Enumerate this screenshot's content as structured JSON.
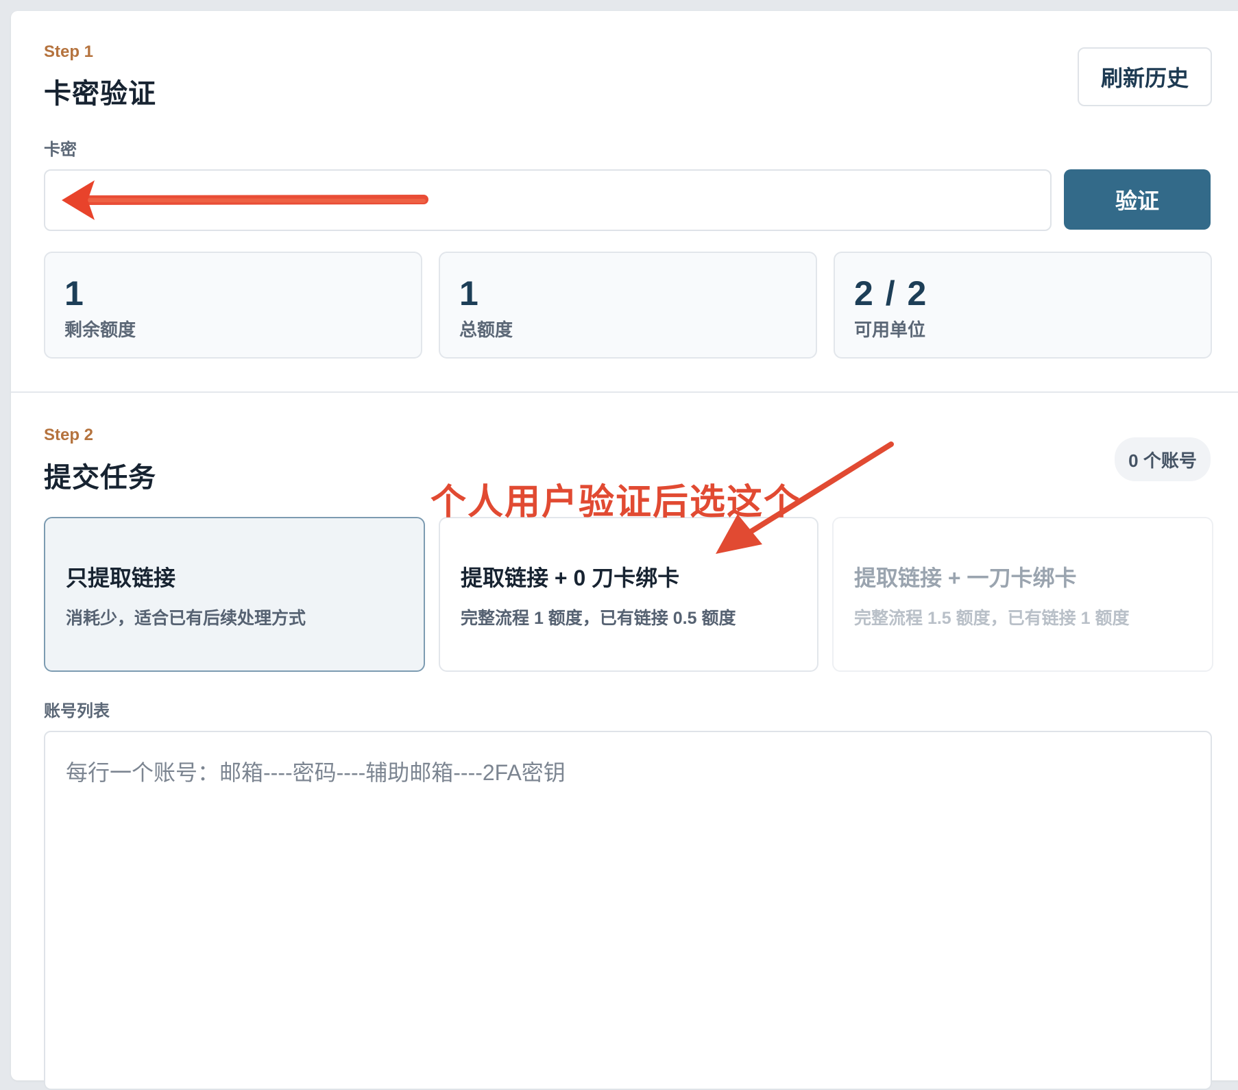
{
  "step1": {
    "step_label": "Step 1",
    "title": "卡密验证",
    "refresh_button": "刷新历史",
    "field_label": "卡密",
    "verify_button": "验证",
    "stats": [
      {
        "value": "1",
        "label": "剩余额度"
      },
      {
        "value": "1",
        "label": "总额度"
      },
      {
        "value": "2 / 2",
        "label": "可用单位"
      }
    ]
  },
  "step2": {
    "step_label": "Step 2",
    "title": "提交任务",
    "account_count": "0 个账号",
    "options": [
      {
        "title": "只提取链接",
        "desc": "消耗少，适合已有后续处理方式",
        "state": "selected"
      },
      {
        "title": "提取链接 + 0 刀卡绑卡",
        "desc": "完整流程 1 额度，已有链接 0.5 额度",
        "state": "normal"
      },
      {
        "title": "提取链接 + 一刀卡绑卡",
        "desc": "完整流程 1.5 额度，已有链接 1 额度",
        "state": "disabled"
      }
    ],
    "accounts_label": "账号列表",
    "accounts_placeholder": "每行一个账号：邮箱----密码----辅助邮箱----2FA密钥"
  },
  "annotation": {
    "text": "个人用户验证后选这个",
    "color": "#e14a32"
  },
  "colors": {
    "accent": "#336a89",
    "step_label": "#b5733e",
    "selected_border": "#7c9bb1"
  }
}
